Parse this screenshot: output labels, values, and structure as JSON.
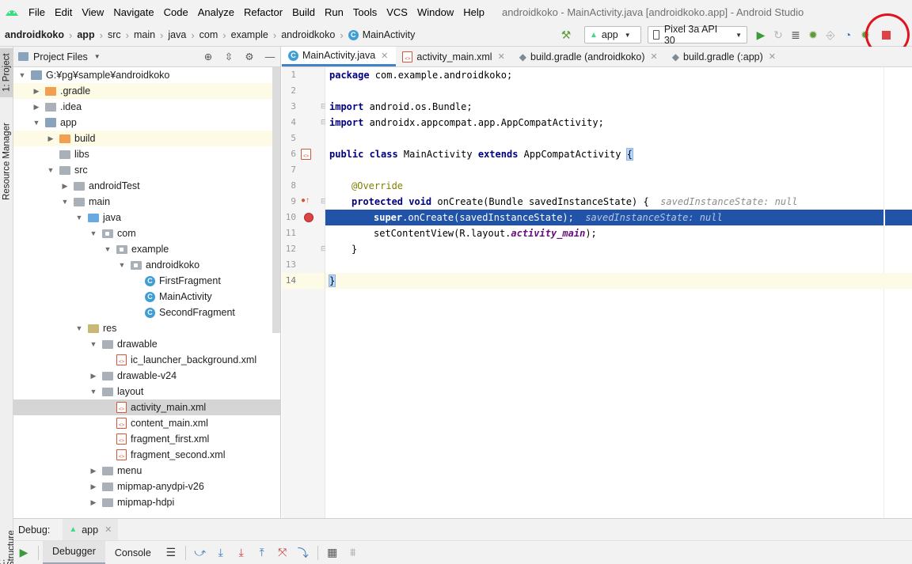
{
  "menubar": {
    "items": [
      {
        "label": "File"
      },
      {
        "label": "Edit"
      },
      {
        "label": "View"
      },
      {
        "label": "Navigate"
      },
      {
        "label": "Code"
      },
      {
        "label": "Analyze"
      },
      {
        "label": "Refactor"
      },
      {
        "label": "Build"
      },
      {
        "label": "Run"
      },
      {
        "label": "Tools"
      },
      {
        "label": "VCS"
      },
      {
        "label": "Window"
      },
      {
        "label": "Help"
      }
    ],
    "window_title": "androidkoko - MainActivity.java [androidkoko.app] - Android Studio"
  },
  "navbar": {
    "crumbs": [
      "androidkoko",
      "app",
      "src",
      "main",
      "java",
      "com",
      "example",
      "androidkoko",
      "MainActivity"
    ],
    "run_config": "app",
    "device": "Pixel 3a API 30"
  },
  "left_stripe": {
    "project_tab": "1: Project",
    "resource_tab": "Resource Manager",
    "structure_tab": "Z: Structure"
  },
  "project_panel": {
    "title": "Project Files",
    "tree": [
      {
        "label": "G:¥pg¥sample¥androidkoko"
      },
      {
        "label": ".gradle"
      },
      {
        "label": ".idea"
      },
      {
        "label": "app"
      },
      {
        "label": "build"
      },
      {
        "label": "libs"
      },
      {
        "label": "src"
      },
      {
        "label": "androidTest"
      },
      {
        "label": "main"
      },
      {
        "label": "java"
      },
      {
        "label": "com"
      },
      {
        "label": "example"
      },
      {
        "label": "androidkoko"
      },
      {
        "label": "FirstFragment"
      },
      {
        "label": "MainActivity"
      },
      {
        "label": "SecondFragment"
      },
      {
        "label": "res"
      },
      {
        "label": "drawable"
      },
      {
        "label": "ic_launcher_background.xml"
      },
      {
        "label": "drawable-v24"
      },
      {
        "label": "layout"
      },
      {
        "label": "activity_main.xml"
      },
      {
        "label": "content_main.xml"
      },
      {
        "label": "fragment_first.xml"
      },
      {
        "label": "fragment_second.xml"
      },
      {
        "label": "menu"
      },
      {
        "label": "mipmap-anydpi-v26"
      },
      {
        "label": "mipmap-hdpi"
      }
    ]
  },
  "editor": {
    "tabs": [
      {
        "label": "MainActivity.java"
      },
      {
        "label": "activity_main.xml"
      },
      {
        "label": "build.gradle (androidkoko)"
      },
      {
        "label": "build.gradle (:app)"
      }
    ],
    "lines": [
      {
        "no": "1",
        "a": "package",
        "b": " com.example.androidkoko;"
      },
      {
        "no": "2"
      },
      {
        "no": "3",
        "a": "import",
        "b": " android.os.Bundle;"
      },
      {
        "no": "4",
        "a": "import",
        "b": " androidx.appcompat.app.AppCompatActivity;"
      },
      {
        "no": "5"
      },
      {
        "no": "6",
        "a": "public class",
        "b": " MainActivity ",
        "c": "extends",
        "d": " AppCompatActivity ",
        "e": "{"
      },
      {
        "no": "7"
      },
      {
        "no": "8",
        "a": "@Override"
      },
      {
        "no": "9",
        "a": "protected void",
        "b": " onCreate(Bundle savedInstanceState) {  ",
        "hint": "savedInstanceState: null"
      },
      {
        "no": "10",
        "a": "super",
        "b": ".onCreate(savedInstanceState);  ",
        "hint": "savedInstanceState: null"
      },
      {
        "no": "11",
        "b": "setContentView(R.layout.",
        "it": "activity_main",
        "c": ");"
      },
      {
        "no": "12",
        "b": "}"
      },
      {
        "no": "13"
      },
      {
        "no": "14",
        "b": "}"
      }
    ]
  },
  "debug": {
    "label": "Debug:",
    "session": "app",
    "tabs": [
      {
        "label": "Debugger"
      },
      {
        "label": "Console"
      }
    ]
  }
}
